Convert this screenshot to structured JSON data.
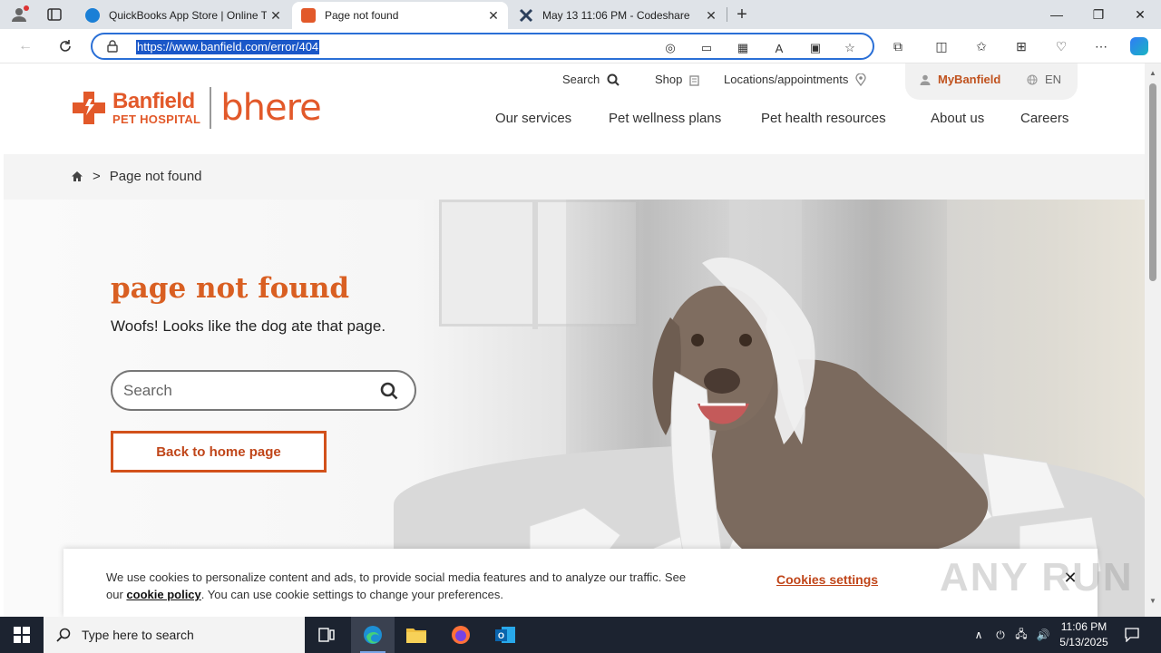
{
  "browser": {
    "tabs": [
      {
        "title": "QuickBooks App Store | Online To",
        "active": false
      },
      {
        "title": "Page not found",
        "active": true
      },
      {
        "title": "May 13 11:06 PM - Codeshare",
        "active": false
      }
    ],
    "url": "https://www.banfield.com/error/404"
  },
  "header": {
    "logo_line1": "Banfield",
    "logo_line2": "PET HOSPITAL",
    "logo_bhere": "bhere",
    "util": {
      "search": "Search",
      "shop": "Shop",
      "locations": "Locations/appointments",
      "mybanfield": "MyBanfield",
      "language": "EN"
    },
    "nav": [
      "Our services",
      "Pet wellness plans",
      "Pet health resources",
      "About us",
      "Careers"
    ]
  },
  "breadcrumb": {
    "separator": ">",
    "current": "Page not found"
  },
  "hero": {
    "title": "page not found",
    "subtitle": "Woofs! Looks like the dog ate that page.",
    "search_placeholder": "Search",
    "home_button": "Back to home page"
  },
  "cookie_banner": {
    "text_before": "We use cookies to personalize content and ads, to provide social media features and to analyze our traffic. See our ",
    "link": "cookie policy",
    "text_after": ". You can use cookie settings to change your preferences.",
    "settings": "Cookies settings"
  },
  "watermark": "ANY RUN",
  "taskbar": {
    "search_placeholder": "Type here to search",
    "time": "11:06 PM",
    "date": "5/13/2025"
  },
  "colors": {
    "brand_orange": "#e2592a",
    "accent_link": "#c0461a",
    "address_focus": "#2a6fd6"
  }
}
